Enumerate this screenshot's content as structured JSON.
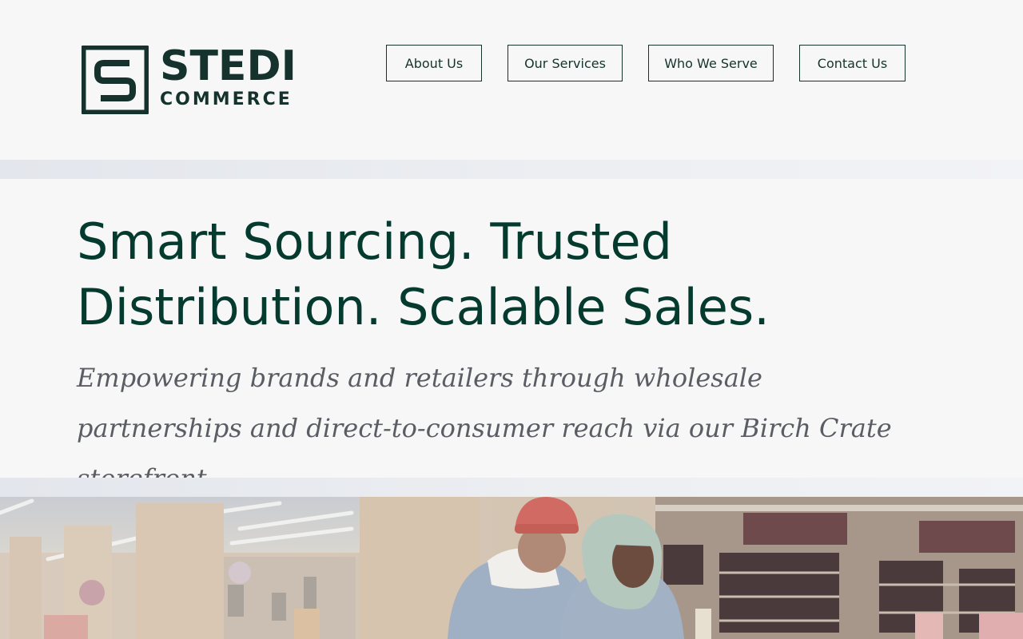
{
  "brand": {
    "name": "STEDI",
    "tagline": "COMMERCE",
    "logo_letter": "S",
    "primary_color": "#15332c",
    "heading_color": "#053a2e"
  },
  "nav": {
    "items": [
      {
        "label": "About Us"
      },
      {
        "label": "Our Services"
      },
      {
        "label": "Who We Serve"
      },
      {
        "label": "Contact Us"
      }
    ]
  },
  "hero": {
    "title": "Smart Sourcing. Trusted Distribution. Scalable Sales.",
    "subtitle": "Empowering brands and retailers through wholesale partnerships and direct-to-consumer reach via our Birch Crate storefront."
  },
  "photo": {
    "icon": "grocery-store-photo"
  }
}
